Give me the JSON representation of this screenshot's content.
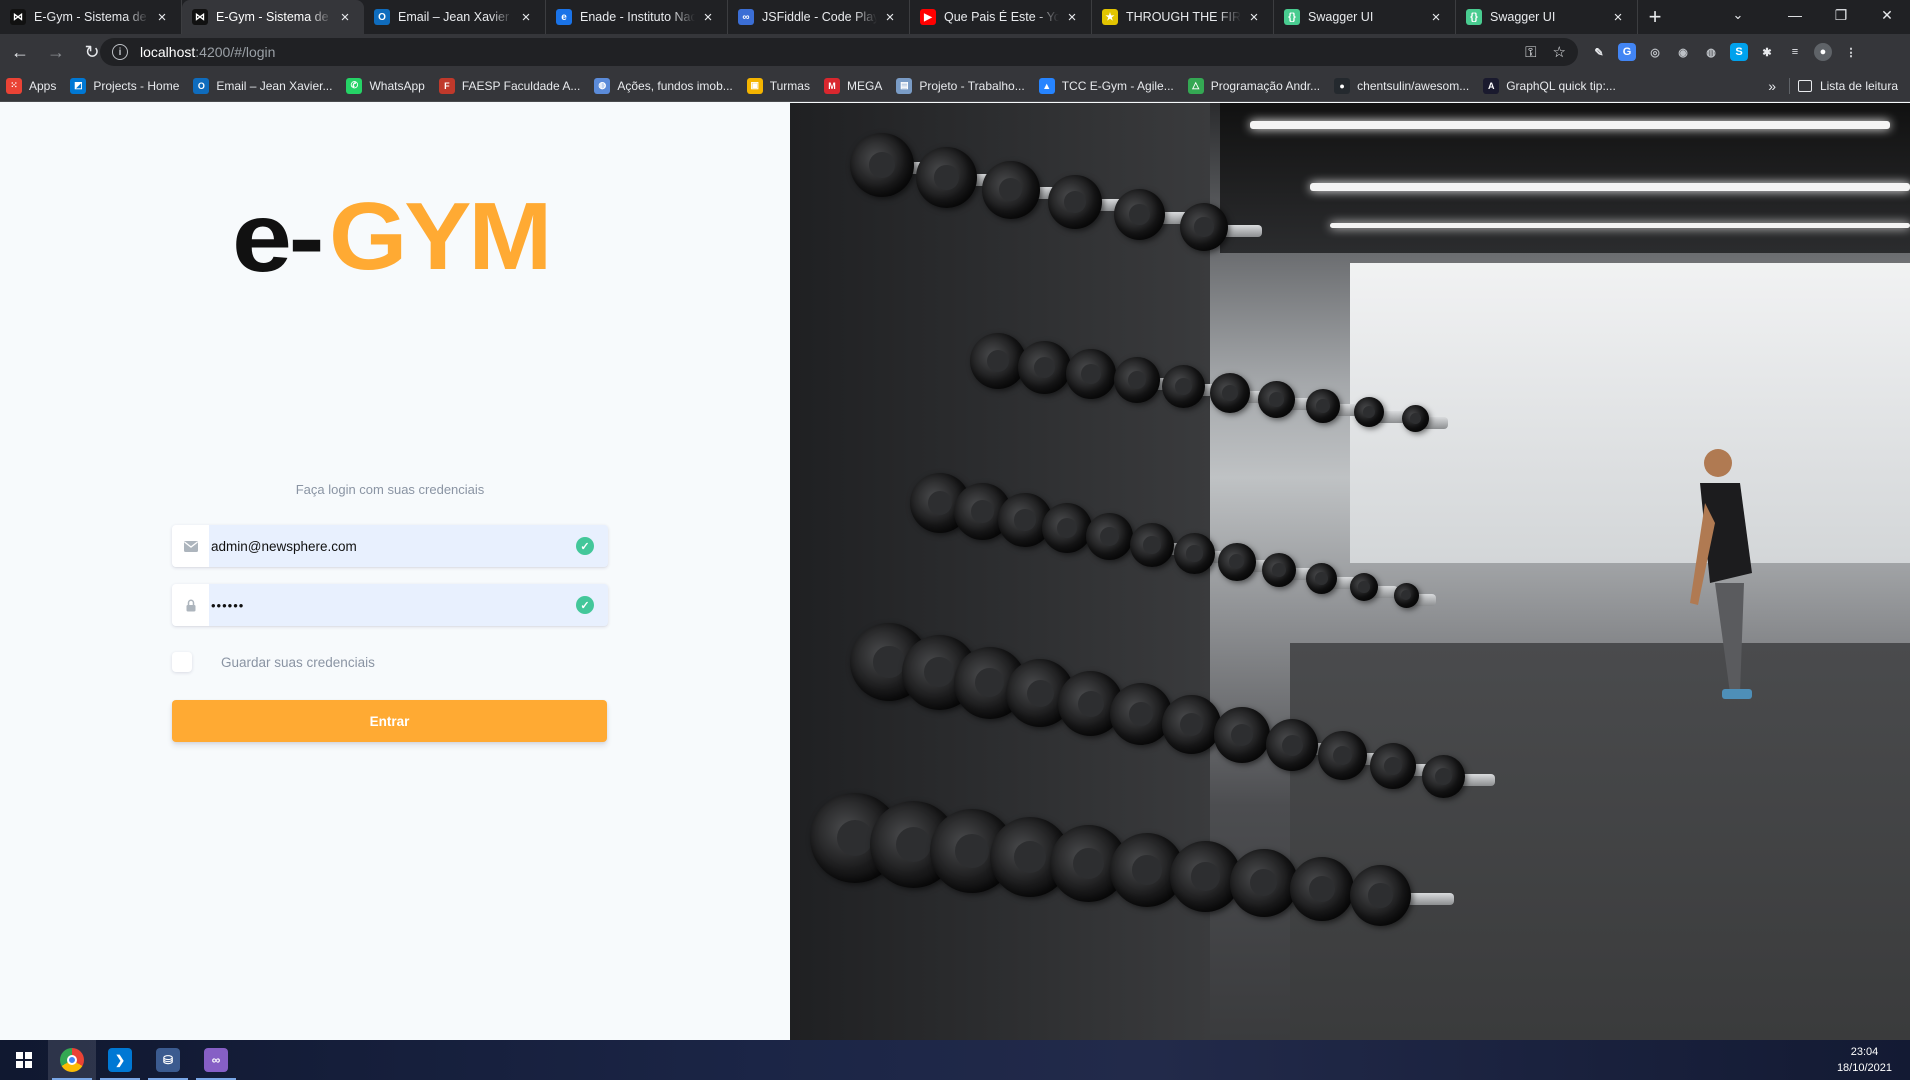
{
  "browser": {
    "tabs": [
      {
        "title": "E-Gym - Sistema de gestão",
        "favicon": "bowtie-icon",
        "color": "#111111",
        "active": false
      },
      {
        "title": "E-Gym - Sistema de gestão",
        "favicon": "bowtie-icon",
        "color": "#111111",
        "active": true
      },
      {
        "title": "Email – Jean Xavier – Outlook",
        "favicon": "outlook-icon",
        "color": "#0f6cbd",
        "active": false
      },
      {
        "title": "Enade - Instituto Nacional",
        "favicon": "edge-e-icon",
        "color": "#1a73e8",
        "active": false
      },
      {
        "title": "JSFiddle - Code Playground",
        "favicon": "jsfiddle-icon",
        "color": "#3b6ed5",
        "active": false
      },
      {
        "title": "Que Pais É Este - YouTube",
        "favicon": "youtube-icon",
        "color": "#ff0000",
        "active": false
      },
      {
        "title": "THROUGH THE FIRE AND FLAMES",
        "favicon": "star-icon",
        "color": "#e2c400",
        "active": false
      },
      {
        "title": "Swagger UI",
        "favicon": "swagger-icon",
        "color": "#49cc90",
        "active": false
      },
      {
        "title": "Swagger UI",
        "favicon": "swagger-icon",
        "color": "#49cc90",
        "active": false
      }
    ],
    "new_tab_label": "+",
    "url_host": "localhost",
    "url_path": ":4200/#/login",
    "bookmarks": [
      {
        "label": "Apps",
        "icon": "apps-grid-icon",
        "color": "#ea4335"
      },
      {
        "label": "Projects - Home",
        "icon": "azure-devops-icon",
        "color": "#0078d4"
      },
      {
        "label": "Email – Jean Xavier...",
        "icon": "outlook-icon",
        "color": "#0f6cbd"
      },
      {
        "label": "WhatsApp",
        "icon": "whatsapp-icon",
        "color": "#25d366"
      },
      {
        "label": "FAESP Faculdade A...",
        "icon": "faesp-icon",
        "color": "#c0392b"
      },
      {
        "label": "Ações, fundos imob...",
        "icon": "globe-icon",
        "color": "#5b8bd9"
      },
      {
        "label": "Turmas",
        "icon": "classroom-icon",
        "color": "#f4b400"
      },
      {
        "label": "MEGA",
        "icon": "mega-icon",
        "color": "#d9272e"
      },
      {
        "label": "Projeto - Trabalho...",
        "icon": "board-icon",
        "color": "#7a9cc6"
      },
      {
        "label": "TCC E-Gym - Agile...",
        "icon": "jira-icon",
        "color": "#2684ff"
      },
      {
        "label": "Programação Andr...",
        "icon": "drive-icon",
        "color": "#34a853"
      },
      {
        "label": "chentsulin/awesom...",
        "icon": "github-icon",
        "color": "#24292e"
      },
      {
        "label": "GraphQL quick tip:...",
        "icon": "graphql-icon",
        "color": "#1a1a2e"
      }
    ],
    "reading_list": "Lista de leitura"
  },
  "login": {
    "logo_e": "e-",
    "logo_gym": "GYM",
    "subtitle": "Faça login com suas credenciais",
    "email_value": "admin@newsphere.com",
    "password_mask": "••••••",
    "remember_label": "Guardar suas credenciais",
    "submit_label": "Entrar",
    "brand_color": "#ffaa33",
    "valid_color": "#43c79a"
  },
  "taskbar": {
    "time": "23:04",
    "date": "18/10/2021"
  }
}
